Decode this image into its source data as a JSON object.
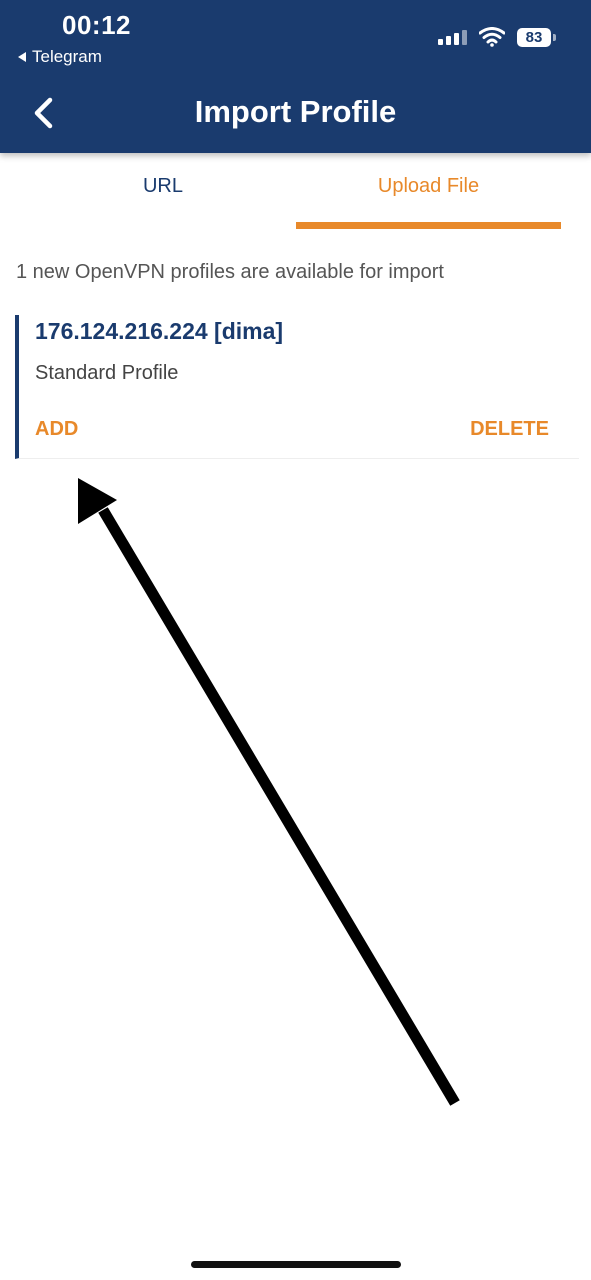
{
  "status_bar": {
    "time": "00:12",
    "back_app": "Telegram",
    "battery": "83"
  },
  "header": {
    "title": "Import Profile"
  },
  "tabs": [
    {
      "label": "URL",
      "active": false
    },
    {
      "label": "Upload File",
      "active": true
    }
  ],
  "info_text": "1 new OpenVPN profiles are available for import",
  "profile": {
    "title": "176.124.216.224 [dima]",
    "subtitle": "Standard Profile",
    "add_label": "ADD",
    "delete_label": "DELETE"
  },
  "colors": {
    "header_bg": "#1a3b6e",
    "accent": "#e8892a",
    "text_primary": "#1a3b6e"
  },
  "icons": [
    "chevron-left-icon",
    "signal-icon",
    "wifi-icon",
    "battery-icon",
    "arrow-annotation"
  ]
}
